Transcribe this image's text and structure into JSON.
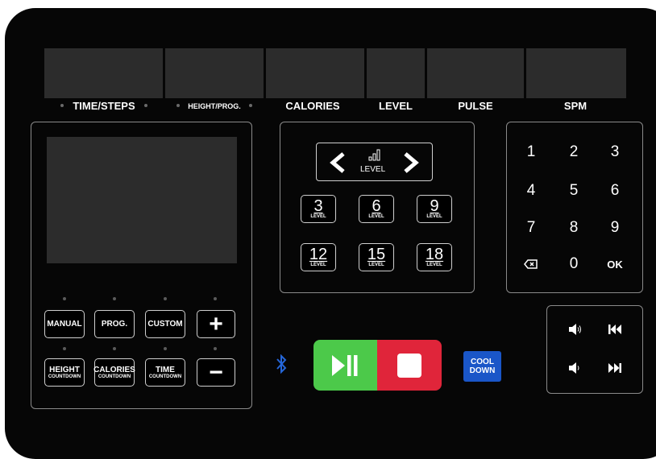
{
  "display_labels": {
    "time_steps": "TIME/STEPS",
    "height_prog": "HEIGHT/PROG.",
    "calories": "CALORIES",
    "level": "LEVEL",
    "pulse": "PULSE",
    "spm": "SPM"
  },
  "level_selector": {
    "label": "LEVEL",
    "presets": [
      {
        "num": "3",
        "label": "LEVEL"
      },
      {
        "num": "6",
        "label": "LEVEL"
      },
      {
        "num": "9",
        "label": "LEVEL"
      },
      {
        "num": "12",
        "label": "LEVEL"
      },
      {
        "num": "15",
        "label": "LEVEL"
      },
      {
        "num": "18",
        "label": "LEVEL"
      }
    ]
  },
  "program_buttons": {
    "manual": "MANUAL",
    "prog": "PROG.",
    "custom": "CUSTOM",
    "plus": "+",
    "height_main": "HEIGHT",
    "height_sub": "COUNTDOWN",
    "calories_main": "CALORIES",
    "calories_sub": "COUNTDOWN",
    "time_main": "TIME",
    "time_sub": "COUNTDOWN",
    "minus": "−"
  },
  "keypad": {
    "keys": [
      "1",
      "2",
      "3",
      "4",
      "5",
      "6",
      "7",
      "8",
      "9"
    ],
    "zero": "0",
    "ok": "OK"
  },
  "cool_down": {
    "line1": "COOL",
    "line2": "DOWN"
  },
  "colors": {
    "start_pause": "#4cc94a",
    "stop": "#e0253a",
    "cool_down": "#1a56c8",
    "bluetooth": "#2566d8"
  }
}
